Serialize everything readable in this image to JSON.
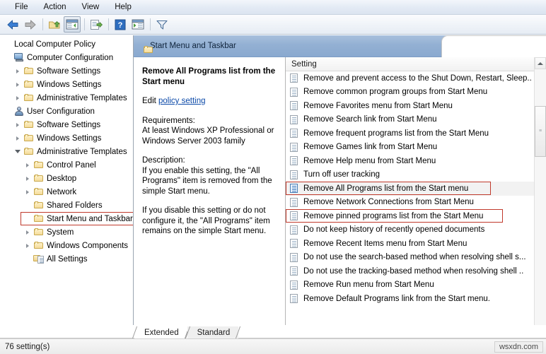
{
  "menubar": {
    "items": [
      {
        "label": "File"
      },
      {
        "label": "Action"
      },
      {
        "label": "View"
      },
      {
        "label": "Help"
      }
    ]
  },
  "toolbar": {
    "buttons": [
      {
        "name": "back-icon",
        "tip": "Back"
      },
      {
        "name": "forward-icon",
        "tip": "Forward"
      },
      {
        "name": "up-folder-icon",
        "tip": "Up one level"
      },
      {
        "name": "show-hide-console-tree-icon",
        "tip": "Show/Hide Console Tree"
      },
      {
        "name": "export-list-icon",
        "tip": "Export List"
      },
      {
        "name": "help-icon",
        "tip": "Help"
      },
      {
        "name": "show-hide-action-pane-icon",
        "tip": "Show/Hide Action Pane"
      },
      {
        "name": "filter-icon",
        "tip": "Filter"
      }
    ]
  },
  "tree": {
    "items": [
      {
        "label": "Local Computer Policy",
        "icon": "none",
        "depth": 0,
        "twisty": "none",
        "highlighted": false
      },
      {
        "label": "Computer Configuration",
        "icon": "computer",
        "depth": 0,
        "twisty": "none",
        "highlighted": false
      },
      {
        "label": "Software Settings",
        "icon": "folder",
        "depth": 1,
        "twisty": "collapsed",
        "highlighted": false
      },
      {
        "label": "Windows Settings",
        "icon": "folder",
        "depth": 1,
        "twisty": "collapsed",
        "highlighted": false
      },
      {
        "label": "Administrative Templates",
        "icon": "folder",
        "depth": 1,
        "twisty": "collapsed",
        "highlighted": false
      },
      {
        "label": "User Configuration",
        "icon": "user",
        "depth": 0,
        "twisty": "none",
        "highlighted": false
      },
      {
        "label": "Software Settings",
        "icon": "folder",
        "depth": 1,
        "twisty": "collapsed",
        "highlighted": false
      },
      {
        "label": "Windows Settings",
        "icon": "folder",
        "depth": 1,
        "twisty": "collapsed",
        "highlighted": false
      },
      {
        "label": "Administrative Templates",
        "icon": "folder",
        "depth": 1,
        "twisty": "expanded",
        "highlighted": false
      },
      {
        "label": "Control Panel",
        "icon": "folder",
        "depth": 2,
        "twisty": "collapsed",
        "highlighted": false
      },
      {
        "label": "Desktop",
        "icon": "folder",
        "depth": 2,
        "twisty": "collapsed",
        "highlighted": false
      },
      {
        "label": "Network",
        "icon": "folder",
        "depth": 2,
        "twisty": "collapsed",
        "highlighted": false
      },
      {
        "label": "Shared Folders",
        "icon": "folder",
        "depth": 2,
        "twisty": "none",
        "highlighted": false
      },
      {
        "label": "Start Menu and Taskbar",
        "icon": "folder",
        "depth": 2,
        "twisty": "none",
        "highlighted": true
      },
      {
        "label": "System",
        "icon": "folder",
        "depth": 2,
        "twisty": "collapsed",
        "highlighted": false
      },
      {
        "label": "Windows Components",
        "icon": "folder",
        "depth": 2,
        "twisty": "collapsed",
        "highlighted": false
      },
      {
        "label": "All Settings",
        "icon": "allsettings",
        "depth": 2,
        "twisty": "none",
        "highlighted": false
      }
    ]
  },
  "header": {
    "title": "Start Menu and Taskbar",
    "icon": "folder-icon"
  },
  "detail": {
    "title": "Remove All Programs list from the Start menu",
    "edit_prefix": "Edit ",
    "edit_link": "policy setting",
    "requirements_label": "Requirements:",
    "requirements_text": "At least Windows XP Professional or Windows Server 2003 family",
    "description_label": "Description:",
    "description_p1": "If you enable this setting, the \"All Programs\" item is removed from the simple Start menu.",
    "description_p2": "If you disable this setting or do not configure it, the \"All Programs\" item remains on the simple Start menu."
  },
  "list": {
    "column_header": "Setting",
    "rows": [
      {
        "label": "Remove and prevent access to the Shut Down, Restart, Sleep..",
        "selected": false,
        "annotated": false
      },
      {
        "label": "Remove common program groups from Start Menu",
        "selected": false,
        "annotated": false
      },
      {
        "label": "Remove Favorites menu from Start Menu",
        "selected": false,
        "annotated": false
      },
      {
        "label": "Remove Search link from Start Menu",
        "selected": false,
        "annotated": false
      },
      {
        "label": "Remove frequent programs list from the Start Menu",
        "selected": false,
        "annotated": false
      },
      {
        "label": "Remove Games link from Start Menu",
        "selected": false,
        "annotated": false
      },
      {
        "label": "Remove Help menu from Start Menu",
        "selected": false,
        "annotated": false
      },
      {
        "label": "Turn off user tracking",
        "selected": false,
        "annotated": false
      },
      {
        "label": "Remove All Programs list from the Start menu",
        "selected": true,
        "annotated": true
      },
      {
        "label": "Remove Network Connections from Start Menu",
        "selected": false,
        "annotated": false
      },
      {
        "label": "Remove pinned programs list from the Start Menu",
        "selected": false,
        "annotated": true
      },
      {
        "label": "Do not keep history of recently opened documents",
        "selected": false,
        "annotated": false
      },
      {
        "label": "Remove Recent Items menu from Start Menu",
        "selected": false,
        "annotated": false
      },
      {
        "label": "Do not use the search-based method when resolving shell s...",
        "selected": false,
        "annotated": false
      },
      {
        "label": "Do not use the tracking-based method when resolving shell ..",
        "selected": false,
        "annotated": false
      },
      {
        "label": "Remove Run menu from Start Menu",
        "selected": false,
        "annotated": false
      },
      {
        "label": "Remove Default Programs link from the Start menu.",
        "selected": false,
        "annotated": false
      }
    ]
  },
  "tabs": [
    {
      "label": "Extended",
      "active": false
    },
    {
      "label": "Standard",
      "active": true
    }
  ],
  "statusbar": {
    "text": "76 setting(s)",
    "watermark": "wsxdn.com"
  },
  "colors": {
    "header_blue": "#93b0d3",
    "annotation_red": "#c0392b",
    "link_blue": "#0b49a8",
    "selection_gray": "#f2f2f2"
  }
}
